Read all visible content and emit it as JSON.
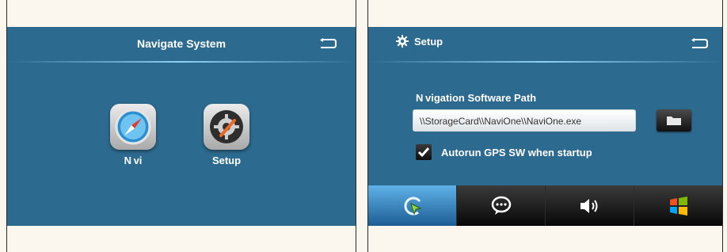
{
  "left": {
    "title": "Navigate System",
    "apps": [
      {
        "label": "N vi",
        "icon": "compass-icon"
      },
      {
        "label": "Setup",
        "icon": "settings-gear-icon"
      }
    ]
  },
  "right": {
    "title": "Setup",
    "path_label": "N vigation Software Path",
    "path_value": "\\\\StorageCard\\\\NaviOne\\\\NaviOne.exe",
    "autorun_label": "Autorun GPS SW when startup",
    "autorun_checked": true,
    "tabs": [
      {
        "icon": "navigation-icon",
        "active": true
      },
      {
        "icon": "chat-icon",
        "active": false
      },
      {
        "icon": "volume-icon",
        "active": false
      },
      {
        "icon": "windows-icon",
        "active": false
      }
    ]
  },
  "colors": {
    "screen_bg": "#2d6a8f",
    "accent": "#8fd0f5",
    "active_tab": "#3f8fcf"
  }
}
